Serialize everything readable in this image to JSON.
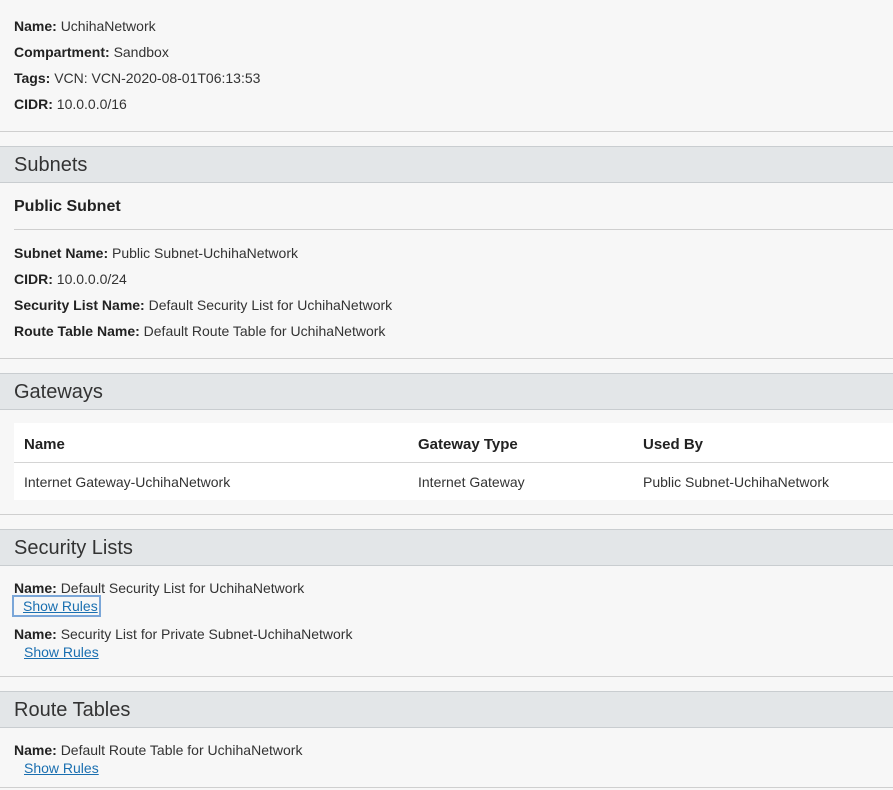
{
  "vcn": {
    "name_label": "Name:",
    "name": "UchihaNetwork",
    "compartment_label": "Compartment:",
    "compartment": "Sandbox",
    "tags_label": "Tags:",
    "tags": "VCN: VCN-2020-08-01T06:13:53",
    "cidr_label": "CIDR:",
    "cidr": "10.0.0.0/16"
  },
  "subnets": {
    "title": "Subnets",
    "subnet_title": "Public Subnet",
    "subnet_name_label": "Subnet Name:",
    "subnet_name": "Public Subnet-UchihaNetwork",
    "cidr_label": "CIDR:",
    "cidr": "10.0.0.0/24",
    "security_list_label": "Security List Name:",
    "security_list": "Default Security List for UchihaNetwork",
    "route_table_label": "Route Table Name:",
    "route_table": "Default Route Table for UchihaNetwork"
  },
  "gateways": {
    "title": "Gateways",
    "columns": [
      "Name",
      "Gateway Type",
      "Used By"
    ],
    "rows": [
      [
        "Internet Gateway-UchihaNetwork",
        "Internet Gateway",
        "Public Subnet-UchihaNetwork"
      ]
    ]
  },
  "security_lists": {
    "title": "Security Lists",
    "items": [
      {
        "name_label": "Name:",
        "name": "Default Security List for UchihaNetwork",
        "link": "Show Rules"
      },
      {
        "name_label": "Name:",
        "name": "Security List for Private Subnet-UchihaNetwork",
        "link": "Show Rules"
      }
    ]
  },
  "route_tables": {
    "title": "Route Tables",
    "items": [
      {
        "name_label": "Name:",
        "name": "Default Route Table for UchihaNetwork",
        "link": "Show Rules"
      }
    ]
  },
  "colors": {
    "link": "#1a6fb0",
    "section_header_bg": "#e3e6e8",
    "page_bg": "#f7f7f7"
  }
}
